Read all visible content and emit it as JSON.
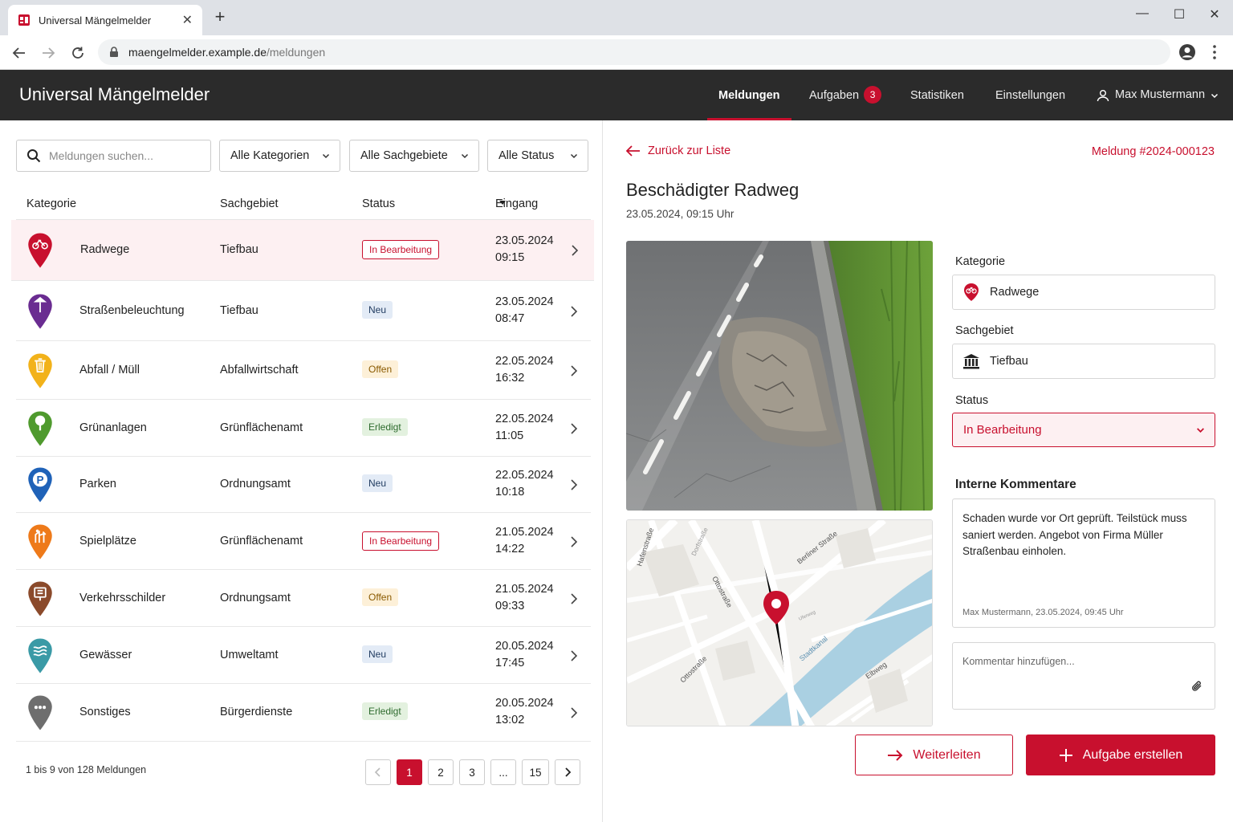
{
  "browser": {
    "tab_title": "Universal Mängelmelder",
    "url_host": "maengelmelder.example.de",
    "url_path": "/meldungen"
  },
  "header": {
    "brand": "Universal Mängelmelder",
    "nav": {
      "meldungen": "Meldungen",
      "aufgaben": "Aufgaben",
      "aufgaben_badge": "3",
      "statistiken": "Statistiken",
      "einstellungen": "Einstellungen",
      "user": "Max Mustermann"
    }
  },
  "filters": {
    "search_placeholder": "Meldungen suchen...",
    "kategorie": "Alle Kategorien",
    "sachgebiet": "Alle Sachgebiete",
    "status": "Alle Status"
  },
  "table": {
    "headers": {
      "kategorie": "Kategorie",
      "sachgebiet": "Sachgebiet",
      "status": "Status",
      "eingang": "Eingang"
    },
    "rows": [
      {
        "kategorie": "Radwege",
        "sachgebiet": "Tiefbau",
        "status": "In Bearbeitung",
        "date": "23.05.2024",
        "time": "09:15",
        "icon": "bicycle-icon",
        "color": "#c8102e"
      },
      {
        "kategorie": "Straßenbeleuchtung",
        "sachgebiet": "Tiefbau",
        "status": "Neu",
        "date": "23.05.2024",
        "time": "08:47",
        "icon": "streetlight-icon",
        "color": "#6a2c91"
      },
      {
        "kategorie": "Abfall / Müll",
        "sachgebiet": "Abfallwirtschaft",
        "status": "Offen",
        "date": "22.05.2024",
        "time": "16:32",
        "icon": "trash-icon",
        "color": "#f2b21a"
      },
      {
        "kategorie": "Grünanlagen",
        "sachgebiet": "Grünflächenamt",
        "status": "Erledigt",
        "date": "22.05.2024",
        "time": "11:05",
        "icon": "tree-icon",
        "color": "#4f9a2e"
      },
      {
        "kategorie": "Parken",
        "sachgebiet": "Ordnungsamt",
        "status": "Neu",
        "date": "22.05.2024",
        "time": "10:18",
        "icon": "parking-icon",
        "color": "#1f62b8"
      },
      {
        "kategorie": "Spielplätze",
        "sachgebiet": "Grünflächenamt",
        "status": "In Bearbeitung",
        "date": "21.05.2024",
        "time": "14:22",
        "icon": "playground-icon",
        "color": "#ee7a1a"
      },
      {
        "kategorie": "Verkehrsschilder",
        "sachgebiet": "Ordnungsamt",
        "status": "Offen",
        "date": "21.05.2024",
        "time": "09:33",
        "icon": "traffic-sign-icon",
        "color": "#8b4a2b"
      },
      {
        "kategorie": "Gewässer",
        "sachgebiet": "Umweltamt",
        "status": "Neu",
        "date": "20.05.2024",
        "time": "17:45",
        "icon": "water-icon",
        "color": "#3a9aa6"
      },
      {
        "kategorie": "Sonstiges",
        "sachgebiet": "Bürgerdienste",
        "status": "Erledigt",
        "date": "20.05.2024",
        "time": "13:02",
        "icon": "more-dots-icon",
        "color": "#6e6e6e"
      }
    ]
  },
  "pagination": {
    "info": "1 bis 9 von 128 Meldungen",
    "pages": [
      "1",
      "2",
      "3",
      "...",
      "15"
    ]
  },
  "detail": {
    "back": "Zurück zur Liste",
    "id": "Meldung #2024-000123",
    "title": "Beschädigter Radweg",
    "datetime": "23.05.2024, 09:15 Uhr",
    "map_labels": {
      "hafenstrasse": "Hafenstraße",
      "dorfstrasse": "Dorfstraße",
      "ottostrasse_a": "Ottostraße",
      "berliner_strasse": "Berliner Straße",
      "uferweg": "Uferweg",
      "stadtkanal": "Stadtkanal",
      "ottostrasse_b": "Ottostraße",
      "elbweg": "Elbweg"
    },
    "kategorie_label": "Kategorie",
    "kategorie_value": "Radwege",
    "sachgebiet_label": "Sachgebiet",
    "sachgebiet_value": "Tiefbau",
    "status_label": "Status",
    "status_value": "In Bearbeitung",
    "comments_title": "Interne Kommentare",
    "comment_text": "Schaden wurde vor Ort geprüft. Teilstück muss saniert werden. Angebot von Firma Müller Straßenbau einholen.",
    "comment_meta": "Max Mustermann, 23.05.2024, 09:45 Uhr",
    "add_comment_placeholder": "Kommentar hinzufügen...",
    "btn_forward": "Weiterleiten",
    "btn_create_task": "Aufgabe erstellen"
  }
}
